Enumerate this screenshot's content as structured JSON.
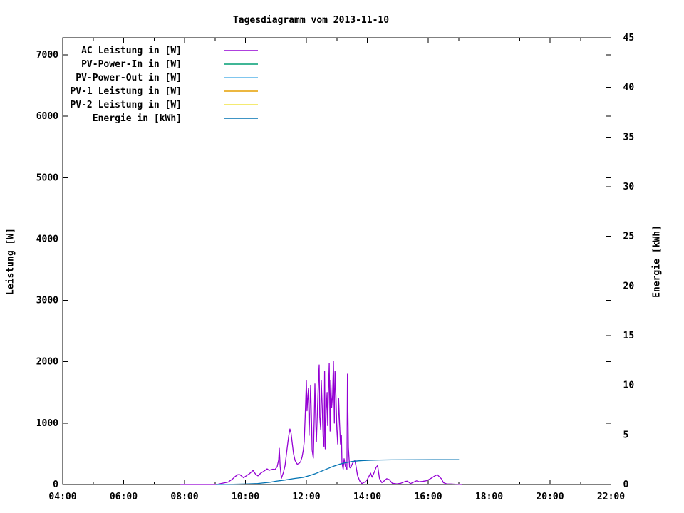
{
  "chart_data": {
    "type": "line",
    "title": "Tagesdiagramm vom 2013-11-10",
    "grid": false,
    "legend_position": "top-left",
    "x_axis": {
      "label": "",
      "unit": "time of day",
      "range": [
        4,
        22
      ],
      "major_ticks": [
        4,
        6,
        8,
        10,
        12,
        14,
        16,
        18,
        20,
        22
      ],
      "major_tick_labels": [
        "04:00",
        "06:00",
        "08:00",
        "10:00",
        "12:00",
        "14:00",
        "16:00",
        "18:00",
        "20:00",
        "22:00"
      ],
      "minor_ticks": [
        5,
        7,
        9,
        11,
        13,
        15,
        17,
        19,
        21
      ]
    },
    "y_left": {
      "label": "Leistung [W]",
      "range": [
        0,
        7280
      ],
      "ticks": [
        0,
        1000,
        2000,
        3000,
        4000,
        5000,
        6000,
        7000
      ],
      "tick_labels": [
        "0",
        "1000",
        "2000",
        "3000",
        "4000",
        "5000",
        "6000",
        "7000"
      ]
    },
    "y_right": {
      "label": "Energie [kWh]",
      "range": [
        0,
        45
      ],
      "ticks": [
        0,
        5,
        10,
        15,
        20,
        25,
        30,
        35,
        40,
        45
      ],
      "tick_labels": [
        "0",
        "5",
        "10",
        "15",
        "20",
        "25",
        "30",
        "35",
        "40",
        "45"
      ]
    },
    "legend": [
      {
        "label": "AC Leistung in [W]",
        "color": "#9400d3"
      },
      {
        "label": "PV-Power-In in [W]",
        "color": "#009e73"
      },
      {
        "label": "PV-Power-Out in [W]",
        "color": "#56b4e9"
      },
      {
        "label": "PV-1 Leistung in [W]",
        "color": "#e69f00"
      },
      {
        "label": "PV-2 Leistung in [W]",
        "color": "#f0e442"
      },
      {
        "label": "Energie in [kWh]",
        "color": "#0072b2"
      }
    ],
    "series": [
      {
        "name": "AC Leistung in [W]",
        "color": "#9400d3",
        "axis": "left",
        "points": [
          [
            7.88,
            0
          ],
          [
            8.56,
            0
          ],
          [
            8.68,
            0
          ],
          [
            8.8,
            0
          ],
          [
            9.05,
            0
          ],
          [
            9.24,
            20
          ],
          [
            9.43,
            40
          ],
          [
            9.58,
            90
          ],
          [
            9.66,
            130
          ],
          [
            9.75,
            160
          ],
          [
            9.82,
            160
          ],
          [
            9.94,
            110
          ],
          [
            10.05,
            150
          ],
          [
            10.13,
            175
          ],
          [
            10.25,
            230
          ],
          [
            10.33,
            170
          ],
          [
            10.41,
            140
          ],
          [
            10.5,
            185
          ],
          [
            10.6,
            215
          ],
          [
            10.71,
            255
          ],
          [
            10.78,
            230
          ],
          [
            10.83,
            240
          ],
          [
            10.9,
            250
          ],
          [
            10.97,
            245
          ],
          [
            11.04,
            290
          ],
          [
            11.09,
            400
          ],
          [
            11.11,
            590
          ],
          [
            11.14,
            300
          ],
          [
            11.18,
            100
          ],
          [
            11.25,
            200
          ],
          [
            11.3,
            310
          ],
          [
            11.37,
            600
          ],
          [
            11.42,
            790
          ],
          [
            11.46,
            905
          ],
          [
            11.5,
            830
          ],
          [
            11.53,
            700
          ],
          [
            11.58,
            500
          ],
          [
            11.63,
            390
          ],
          [
            11.7,
            330
          ],
          [
            11.76,
            345
          ],
          [
            11.81,
            370
          ],
          [
            11.86,
            450
          ],
          [
            11.9,
            560
          ],
          [
            11.93,
            700
          ],
          [
            11.96,
            1100
          ],
          [
            12.0,
            1690
          ],
          [
            12.02,
            1200
          ],
          [
            12.05,
            1450
          ],
          [
            12.07,
            1570
          ],
          [
            12.09,
            800
          ],
          [
            12.12,
            1280
          ],
          [
            12.14,
            1620
          ],
          [
            12.17,
            1000
          ],
          [
            12.19,
            560
          ],
          [
            12.23,
            430
          ],
          [
            12.26,
            1100
          ],
          [
            12.28,
            1640
          ],
          [
            12.31,
            950
          ],
          [
            12.33,
            700
          ],
          [
            12.37,
            1300
          ],
          [
            12.4,
            1740
          ],
          [
            12.42,
            1950
          ],
          [
            12.44,
            1100
          ],
          [
            12.47,
            900
          ],
          [
            12.49,
            1700
          ],
          [
            12.52,
            1280
          ],
          [
            12.55,
            780
          ],
          [
            12.58,
            620
          ],
          [
            12.6,
            1850
          ],
          [
            12.62,
            580
          ],
          [
            12.65,
            1200
          ],
          [
            12.68,
            1500
          ],
          [
            12.7,
            960
          ],
          [
            12.73,
            1600
          ],
          [
            12.75,
            1975
          ],
          [
            12.78,
            870
          ],
          [
            12.8,
            1700
          ],
          [
            12.83,
            1250
          ],
          [
            12.86,
            1450
          ],
          [
            12.89,
            2010
          ],
          [
            12.92,
            1000
          ],
          [
            12.94,
            1850
          ],
          [
            12.97,
            1450
          ],
          [
            13.0,
            900
          ],
          [
            13.03,
            660
          ],
          [
            13.06,
            1400
          ],
          [
            13.09,
            1000
          ],
          [
            13.12,
            660
          ],
          [
            13.15,
            800
          ],
          [
            13.17,
            350
          ],
          [
            13.21,
            250
          ],
          [
            13.24,
            420
          ],
          [
            13.28,
            300
          ],
          [
            13.33,
            250
          ],
          [
            13.35,
            1800
          ],
          [
            13.38,
            600
          ],
          [
            13.42,
            280
          ],
          [
            13.45,
            270
          ],
          [
            13.52,
            350
          ],
          [
            13.59,
            390
          ],
          [
            13.63,
            300
          ],
          [
            13.68,
            150
          ],
          [
            13.75,
            60
          ],
          [
            13.82,
            15
          ],
          [
            13.92,
            40
          ],
          [
            14.0,
            80
          ],
          [
            14.11,
            185
          ],
          [
            14.16,
            120
          ],
          [
            14.23,
            200
          ],
          [
            14.29,
            280
          ],
          [
            14.34,
            310
          ],
          [
            14.4,
            100
          ],
          [
            14.48,
            30
          ],
          [
            14.56,
            60
          ],
          [
            14.64,
            95
          ],
          [
            14.72,
            80
          ],
          [
            14.82,
            20
          ],
          [
            14.97,
            10
          ],
          [
            15.1,
            20
          ],
          [
            15.25,
            50
          ],
          [
            15.32,
            55
          ],
          [
            15.42,
            15
          ],
          [
            15.55,
            45
          ],
          [
            15.62,
            60
          ],
          [
            15.7,
            45
          ],
          [
            15.8,
            50
          ],
          [
            15.93,
            60
          ],
          [
            16.02,
            80
          ],
          [
            16.09,
            100
          ],
          [
            16.2,
            135
          ],
          [
            16.3,
            160
          ],
          [
            16.38,
            120
          ],
          [
            16.44,
            90
          ],
          [
            16.5,
            30
          ],
          [
            16.6,
            10
          ],
          [
            16.75,
            8
          ],
          [
            16.9,
            5
          ],
          [
            17.1,
            0
          ]
        ]
      },
      {
        "name": "Energie in [kWh]",
        "color": "#0072b2",
        "axis": "right",
        "points": [
          [
            9.05,
            0
          ],
          [
            9.6,
            0.02
          ],
          [
            10.0,
            0.05
          ],
          [
            10.4,
            0.1
          ],
          [
            10.8,
            0.22
          ],
          [
            11.0,
            0.33
          ],
          [
            11.3,
            0.45
          ],
          [
            11.6,
            0.6
          ],
          [
            11.9,
            0.72
          ],
          [
            12.1,
            0.9
          ],
          [
            12.3,
            1.1
          ],
          [
            12.5,
            1.35
          ],
          [
            12.7,
            1.6
          ],
          [
            12.9,
            1.85
          ],
          [
            13.1,
            2.05
          ],
          [
            13.3,
            2.2
          ],
          [
            13.5,
            2.32
          ],
          [
            13.7,
            2.38
          ],
          [
            13.9,
            2.42
          ],
          [
            14.1,
            2.44
          ],
          [
            14.4,
            2.47
          ],
          [
            14.8,
            2.48
          ],
          [
            15.5,
            2.49
          ],
          [
            16.2,
            2.5
          ],
          [
            17.0,
            2.5
          ]
        ]
      }
    ]
  }
}
